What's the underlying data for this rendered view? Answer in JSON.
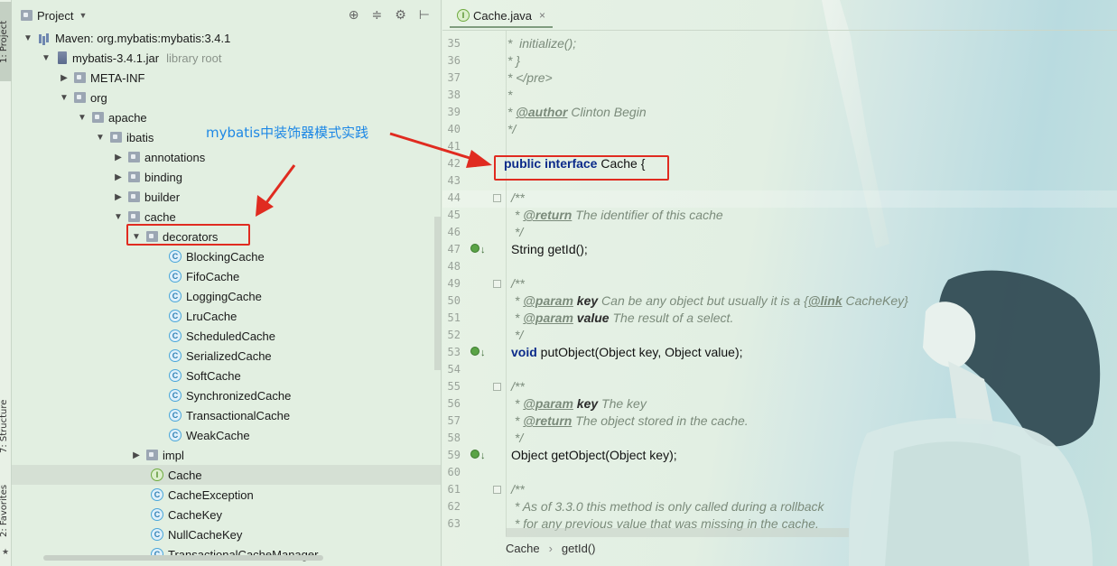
{
  "sidebar": {
    "project_tab": "1: Project",
    "structure_tab": "7: Structure",
    "favorites_tab": "2: Favorites"
  },
  "panel": {
    "title": "Project",
    "icons": [
      "locate-icon",
      "collapse-icon",
      "gear-icon",
      "hide-icon"
    ]
  },
  "tree": {
    "maven": "Maven: org.mybatis:mybatis:3.4.1",
    "jar": "mybatis-3.4.1.jar",
    "jar_hint": "library root",
    "meta_inf": "META-INF",
    "org": "org",
    "apache": "apache",
    "ibatis": "ibatis",
    "annotations": "annotations",
    "binding": "binding",
    "builder": "builder",
    "cache": "cache",
    "decorators": "decorators",
    "decorator_classes": [
      "BlockingCache",
      "FifoCache",
      "LoggingCache",
      "LruCache",
      "ScheduledCache",
      "SerializedCache",
      "SoftCache",
      "SynchronizedCache",
      "TransactionalCache",
      "WeakCache"
    ],
    "impl": "impl",
    "cache_items": [
      "Cache",
      "CacheException",
      "CacheKey",
      "NullCacheKey",
      "TransactionalCacheManager"
    ]
  },
  "annotation": "mybatis中装饰器模式实践",
  "editor": {
    "tab_label": "Cache.java",
    "line_numbers": [
      "35",
      "36",
      "37",
      "38",
      "39",
      "40",
      "41",
      "42",
      "43",
      "44",
      "45",
      "46",
      "47",
      "48",
      "49",
      "50",
      "51",
      "52",
      "53",
      "54",
      "55",
      "56",
      "57",
      "58",
      "59",
      "60",
      "61",
      "62",
      "63"
    ],
    "code": {
      "l35": " *  initialize();",
      "l36": " * }",
      "l37": " * </pre>",
      "l38": " *",
      "l39_tag": "@author",
      "l39_text": " Clinton Begin",
      "l40": " */",
      "l42_kw": "public interface",
      "l42_rest": " Cache {",
      "l44": "/**",
      "l45_tag": "@return",
      "l45_text": " The identifier of this cache",
      "l46": " */",
      "l47": "String getId();",
      "l49": "/**",
      "l50_tag": "@param",
      "l50_name": "key",
      "l50_text": " Can be any object but usually it is a {",
      "l50_link": "@link",
      "l50_ref": " CacheKey",
      "l50_end": "}",
      "l51_tag": "@param",
      "l51_name": "value",
      "l51_text": " The result of a select.",
      "l52": " */",
      "l53_kw": "void",
      "l53_rest": " putObject(Object key, Object value);",
      "l55": "/**",
      "l56_tag": "@param",
      "l56_name": "key",
      "l56_text": " The key",
      "l57_tag": "@return",
      "l57_text": " The object stored in the cache.",
      "l58": " */",
      "l59": "Object getObject(Object key);",
      "l61": "/**",
      "l62": " * As of 3.3.0 this method is only called during a rollback",
      "l63": " * for any previous value that was missing in the cache."
    },
    "breadcrumb": [
      "Cache",
      "getId()"
    ],
    "breadcrumb_sep": "›"
  },
  "colors": {
    "highlight_box": "#e02b20",
    "annotation_text": "#1e88e5",
    "keyword": "#0b2b8a"
  }
}
